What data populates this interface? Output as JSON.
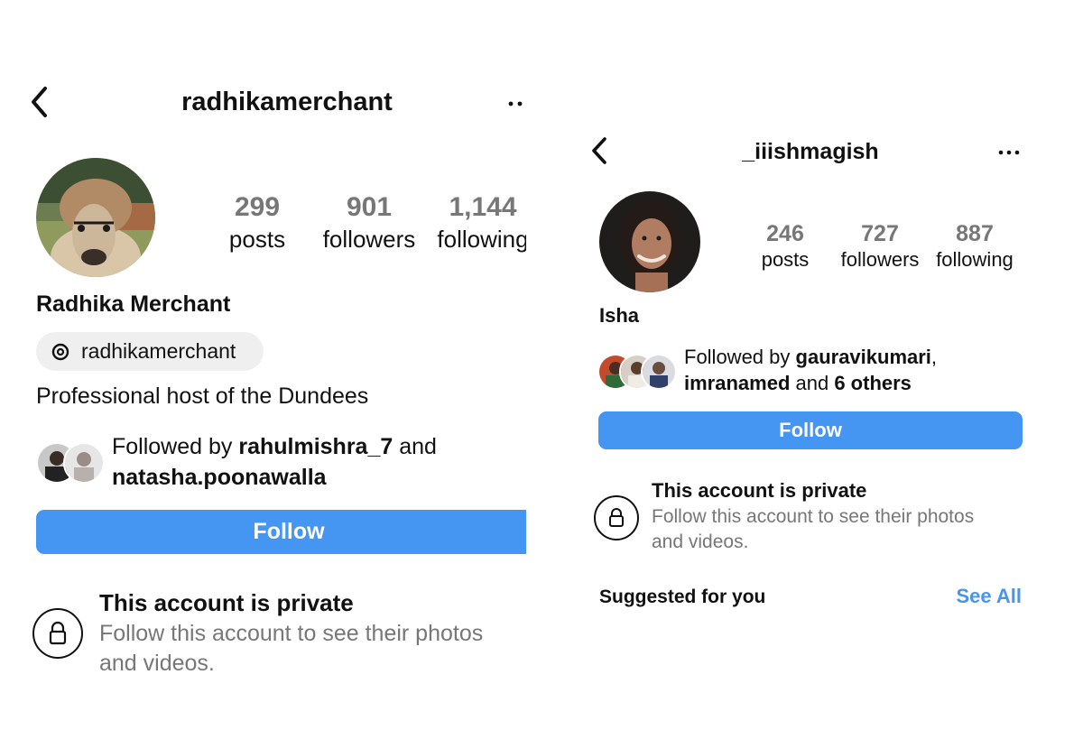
{
  "left": {
    "username": "radhikamerchant",
    "stats": [
      {
        "value": "299",
        "label": "posts"
      },
      {
        "value": "901",
        "label": "followers"
      },
      {
        "value": "1,144",
        "label": "following"
      }
    ],
    "display_name": "Radhika Merchant",
    "threads_handle": "radhikamerchant",
    "bio": "Professional host of the Dundees",
    "followed_by": {
      "prefix": "Followed by ",
      "user1": "rahulmishra_7",
      "joiner": " and",
      "user2": "natasha.poonawalla"
    },
    "follow_label": "Follow",
    "private_title": "This account is private",
    "private_desc_line1": "Follow this account to see their photos",
    "private_desc_line2": "and videos."
  },
  "right": {
    "username": "_iiishmagish",
    "stats": [
      {
        "value": "246",
        "label": "posts"
      },
      {
        "value": "727",
        "label": "followers"
      },
      {
        "value": "887",
        "label": "following"
      }
    ],
    "display_name": "Isha",
    "followed_by": {
      "prefix": "Followed by ",
      "user1": "gauravikumari",
      "comma": ",",
      "user2": "imranamed",
      "joiner": " and ",
      "others": "6 others"
    },
    "follow_label": "Follow",
    "private_title": "This account is private",
    "private_desc_line1": "Follow this account to see their photos",
    "private_desc_line2": "and videos.",
    "suggested_label": "Suggested for you",
    "see_all_label": "See All"
  },
  "colors": {
    "accent": "#4596f2",
    "muted_text": "#777777",
    "pill_bg": "#efefef"
  }
}
